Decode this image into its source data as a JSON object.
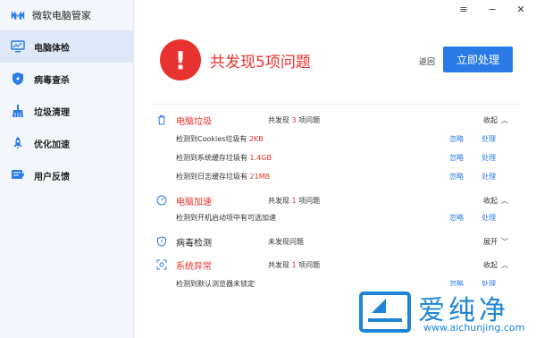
{
  "app": {
    "title": "微软电脑管家"
  },
  "sidebar": {
    "items": [
      {
        "label": "电脑体检",
        "icon": "monitor-icon",
        "active": true
      },
      {
        "label": "病毒查杀",
        "icon": "shield-icon",
        "active": false
      },
      {
        "label": "垃圾清理",
        "icon": "broom-icon",
        "active": false
      },
      {
        "label": "优化加速",
        "icon": "rocket-icon",
        "active": false
      },
      {
        "label": "用户反馈",
        "icon": "feedback-icon",
        "active": false
      }
    ]
  },
  "window": {
    "menu": "≡",
    "minimize": "−",
    "close": "✕"
  },
  "hero": {
    "headline": "共发现5项问题",
    "back": "返回",
    "fix": "立即处理"
  },
  "sections": [
    {
      "title": "电脑垃圾",
      "count_prefix": "共发现",
      "count": "3",
      "count_suffix": "项问题",
      "toggle": "收起",
      "items": [
        {
          "text_prefix": "检测到Cookies垃圾有",
          "value": "2KB",
          "ignore": "忽略",
          "action": "处理"
        },
        {
          "text_prefix": "检测到系统缓存垃圾有",
          "value": "1.4GB",
          "ignore": "忽略",
          "action": "处理"
        },
        {
          "text_prefix": "检测到日志缓存垃圾有",
          "value": "21MB",
          "ignore": "忽略",
          "action": "处理"
        }
      ]
    },
    {
      "title": "电脑加速",
      "count_prefix": "共发现",
      "count": "1",
      "count_suffix": "项问题",
      "toggle": "收起",
      "items": [
        {
          "text_prefix": "检测到开机启动项中有可选加速",
          "value": "",
          "ignore": "忽略",
          "action": "处理"
        }
      ]
    },
    {
      "title": "病毒检测",
      "count_prefix": "未发现问题",
      "count": "",
      "count_suffix": "",
      "toggle": "展开",
      "items": []
    },
    {
      "title": "系统异常",
      "count_prefix": "共发现",
      "count": "1",
      "count_suffix": "项问题",
      "toggle": "收起",
      "items": [
        {
          "text_prefix": "检测到默认浏览器未锁定",
          "value": "",
          "ignore": "忽略",
          "action": "处理"
        }
      ]
    }
  ],
  "watermark": {
    "brand": "爱纯净",
    "url": "www.aichunjing.com"
  },
  "colors": {
    "accent": "#2a7be8",
    "alert": "#e8322f",
    "sidebar_bg": "#f3f6fb"
  }
}
